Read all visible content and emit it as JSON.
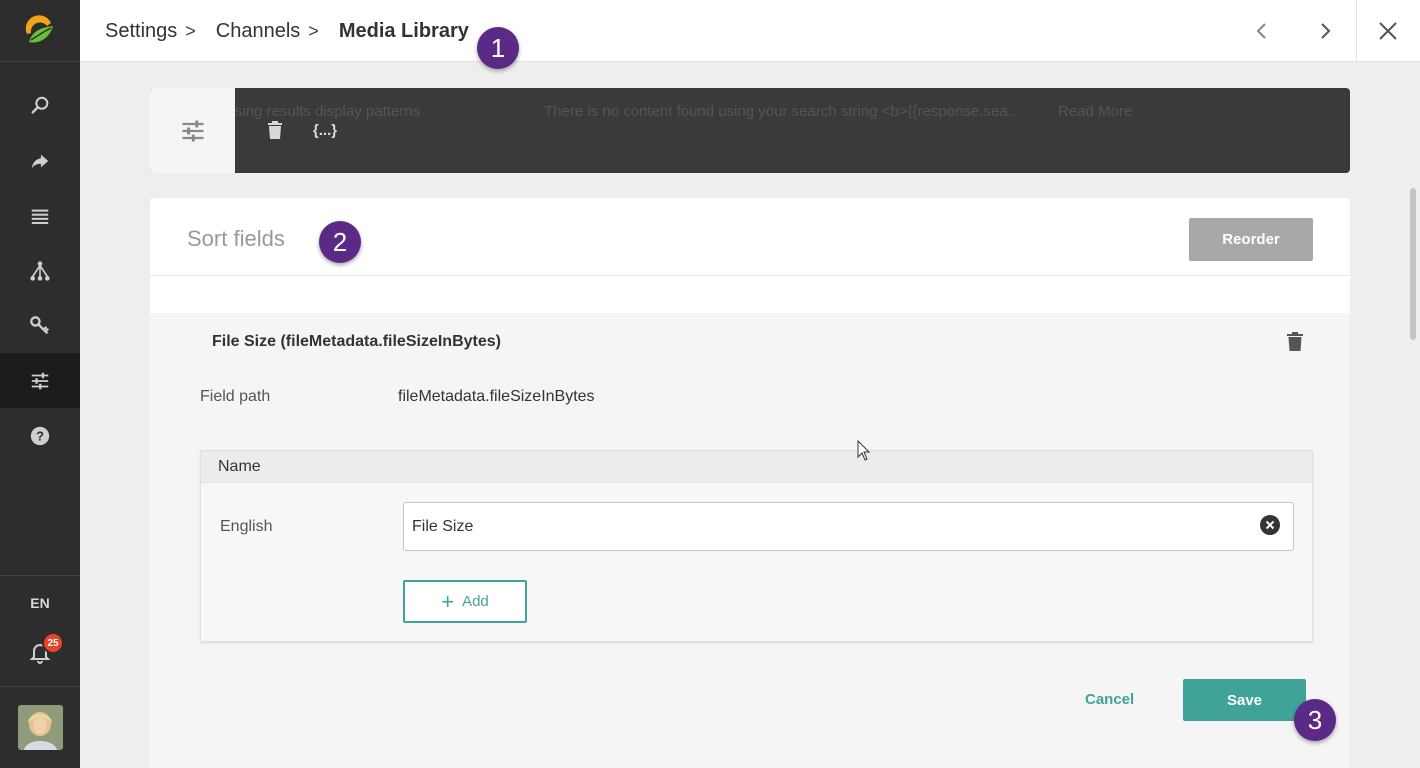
{
  "breadcrumb": {
    "items": [
      "Settings",
      "Channels"
    ],
    "current": "Media Library",
    "separator": ">"
  },
  "markers": [
    "1",
    "2",
    "3"
  ],
  "sidebar": {
    "language": "EN",
    "notification_count": "25",
    "icons": [
      "search-icon",
      "share-icon",
      "list-icon",
      "hierarchy-icon",
      "key-icon",
      "sliders-icon",
      "help-icon"
    ],
    "active_item": "sliders-icon"
  },
  "toolbar": {
    "ghost_left": "sing results display patterns",
    "ghost_right": "There is no content found using your search string <b>{{response.sea...",
    "ghost_link": "Read More",
    "code_icon_label": "{...}"
  },
  "sort_fields": {
    "title": "Sort fields",
    "reorder_label": "Reorder",
    "item": {
      "title": "File Size (fileMetadata.fileSizeInBytes)",
      "field_path_label": "Field path",
      "field_path_value": "fileMetadata.fileSizeInBytes",
      "name_section": {
        "header": "Name",
        "language_label": "English",
        "value": "File Size",
        "add_label": "Add"
      }
    },
    "cancel_label": "Cancel",
    "save_label": "Save"
  },
  "colors": {
    "accent": "#3fa39a",
    "marker": "#5b2a86",
    "sidebar": "#2d2d2d",
    "badge": "#e8442c"
  }
}
